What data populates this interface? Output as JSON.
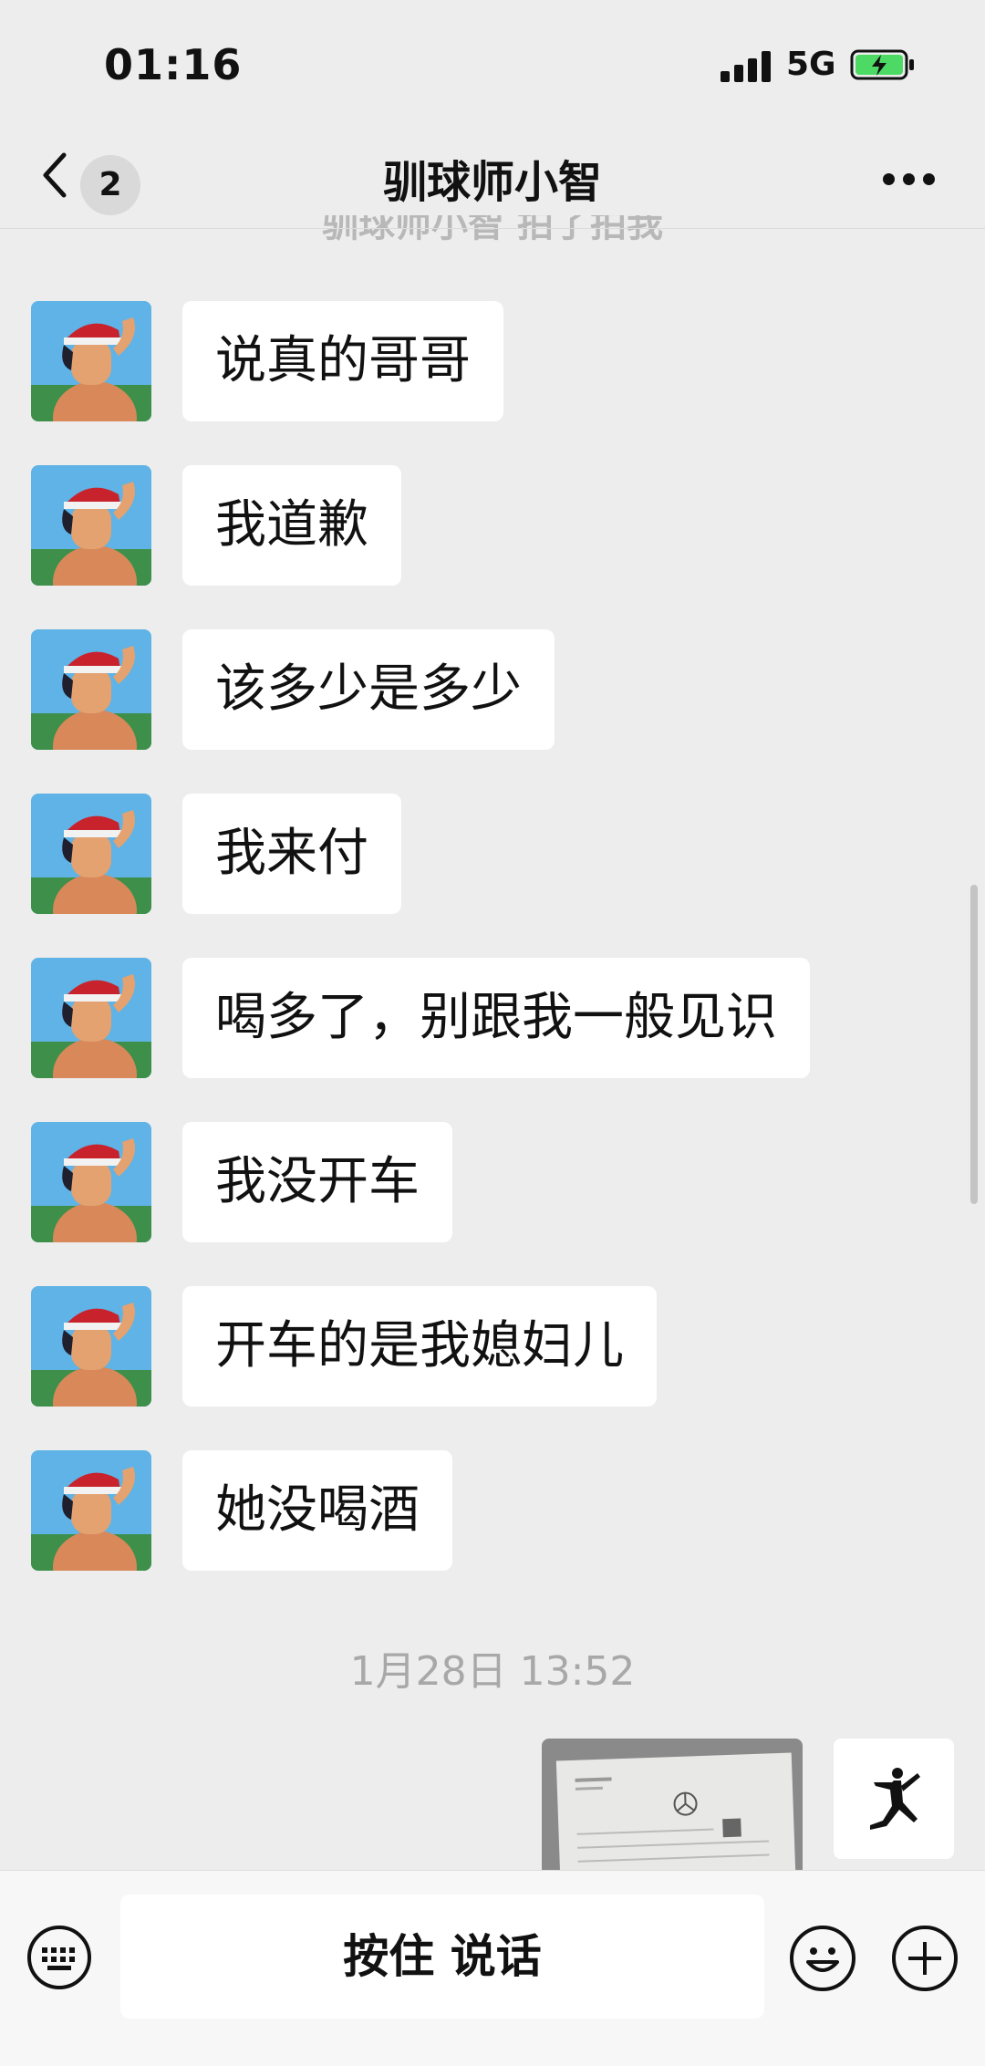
{
  "status_bar": {
    "time": "01:16",
    "network": "5G"
  },
  "nav": {
    "back_count": "2",
    "title": "驯球师小智",
    "partial_text": "驯球师小智 拍了拍我"
  },
  "messages": [
    {
      "text": "说真的哥哥"
    },
    {
      "text": "我道歉"
    },
    {
      "text": "该多少是多少"
    },
    {
      "text": "我来付"
    },
    {
      "text": "喝多了，别跟我一般见识"
    },
    {
      "text": "我没开车"
    },
    {
      "text": "开车的是我媳妇儿"
    },
    {
      "text": "她没喝酒"
    }
  ],
  "timestamp": "1月28日 13:52",
  "input": {
    "voice_label": "按住 说话"
  },
  "colors": {
    "background": "#ededed",
    "bubble": "#ffffff",
    "battery_charging": "#4cd964"
  },
  "icons": [
    "back-chevron-icon",
    "more-icon",
    "keyboard-icon",
    "emoji-icon",
    "plus-icon"
  ]
}
